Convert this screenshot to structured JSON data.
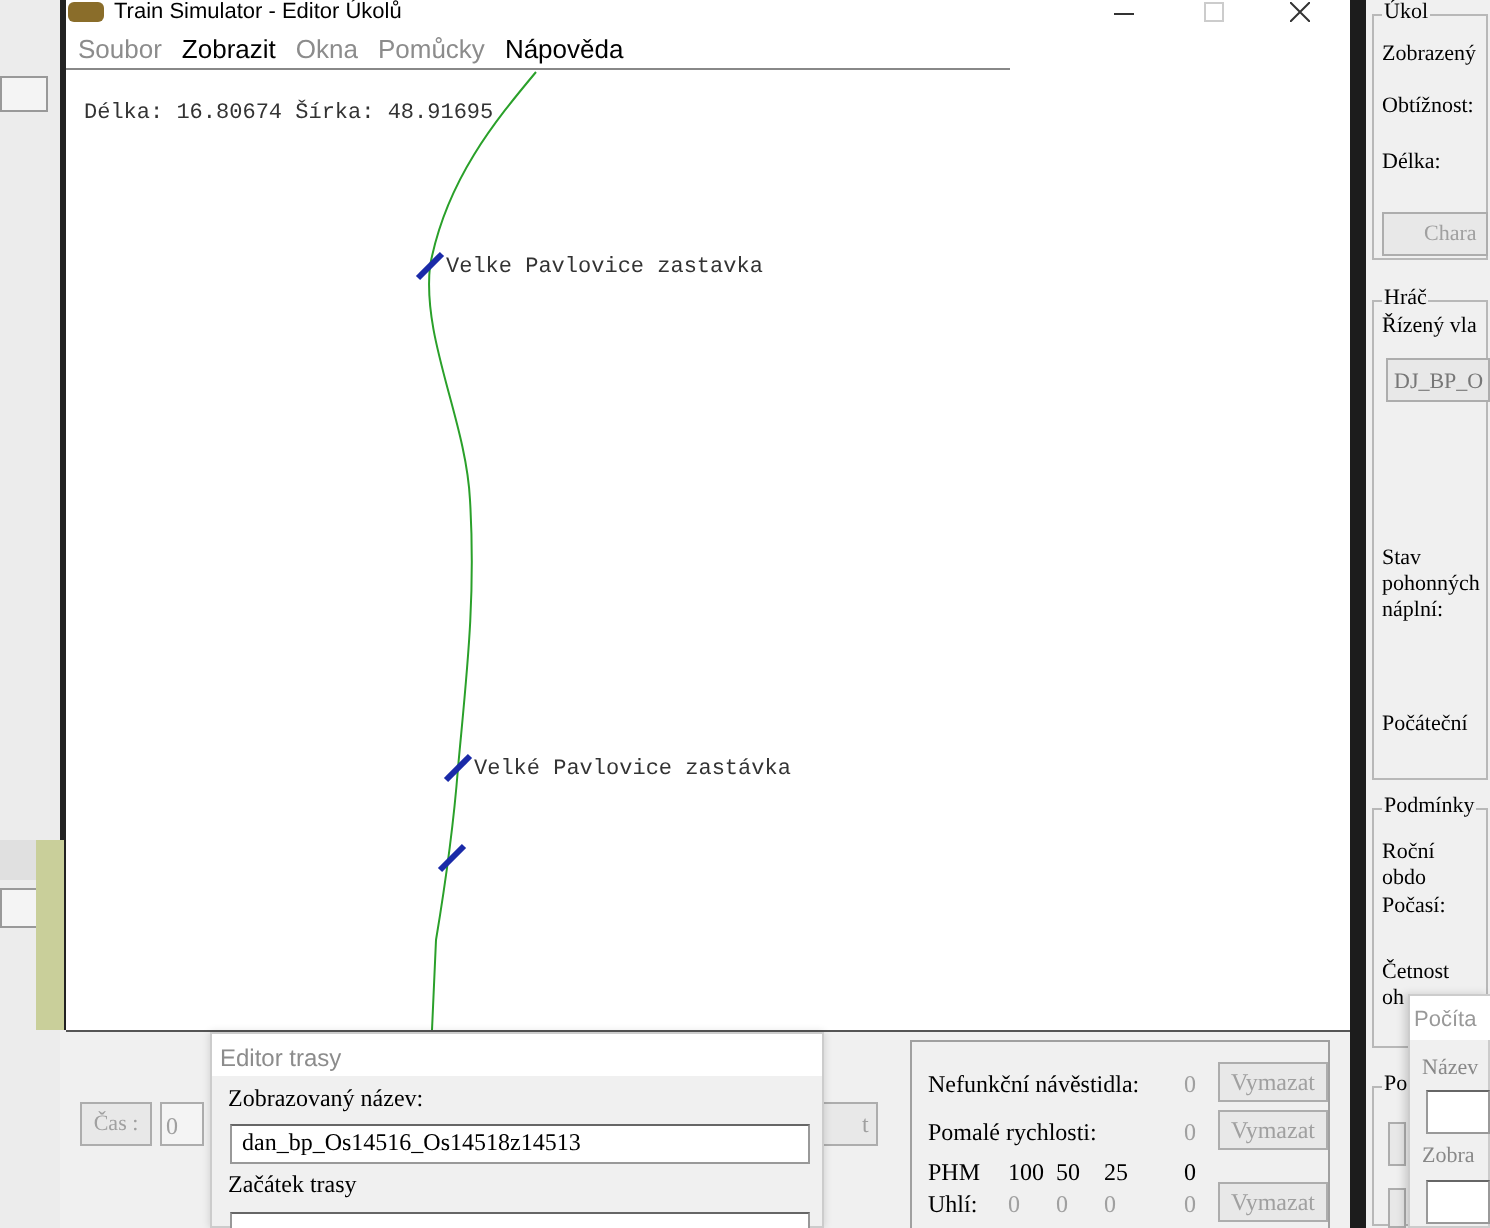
{
  "main_window": {
    "title": "Train Simulator - Editor Úkolů",
    "menu": [
      {
        "label": "Soubor",
        "disabled": true
      },
      {
        "label": "Zobrazit",
        "disabled": false
      },
      {
        "label": "Okna",
        "disabled": true
      },
      {
        "label": "Pomůcky",
        "disabled": true
      },
      {
        "label": "Nápověda",
        "disabled": false
      }
    ],
    "map": {
      "coordinates": "Délka: 16.80674 Šírka: 48.91695",
      "stations": [
        {
          "kind": "labelled",
          "label": "Velke Pavlovice zastavka"
        },
        {
          "kind": "labelled",
          "label": "Velké Pavlovice zastávka"
        },
        {
          "kind": "marker"
        }
      ]
    }
  },
  "task_panel": {
    "task": {
      "legend": "Úkol",
      "labels": [
        "Zobrazený",
        "Obtížnost:",
        "Délka:"
      ],
      "button": {
        "label": "Chara",
        "disabled": true
      }
    },
    "player": {
      "legend": "Hráč",
      "train_label": "Řízený vla",
      "train_value": "DJ_BP_O",
      "fuel_label": "Stav pohonných náplní:",
      "start_label": "Počáteční"
    },
    "conditions": {
      "legend": "Podmínky",
      "labels": [
        "Roční obdo",
        "Počasí:",
        "Četnost oh"
      ]
    },
    "group_4": {
      "legend": "Po"
    }
  },
  "computer_window": {
    "title": "Počíta",
    "name_label": "Název",
    "display_label": "Zobra"
  },
  "time": {
    "button": "Čas :",
    "value": "0"
  },
  "hidden_button": "t",
  "route_editor": {
    "title": "Editor trasy",
    "display_name_label": "Zobrazovaný název:",
    "display_name": "dan_bp_Os14516_Os14518z14513",
    "start_label": "Začátek trasy"
  },
  "stats": {
    "rows": [
      {
        "kind": "counter",
        "label": "Nefunkční návěstidla:",
        "values": [
          "0"
        ],
        "button": "Vymazat"
      },
      {
        "kind": "counter",
        "label": "Pomalé rychlosti:",
        "values": [
          "0"
        ],
        "button": "Vymazat"
      },
      {
        "kind": "header",
        "label": "PHM",
        "values": [
          "100",
          "50",
          "25",
          "0"
        ]
      },
      {
        "kind": "counter",
        "label": "Uhlí:",
        "values": [
          "0",
          "0",
          "0",
          "0"
        ],
        "button": "Vymazat"
      }
    ]
  }
}
